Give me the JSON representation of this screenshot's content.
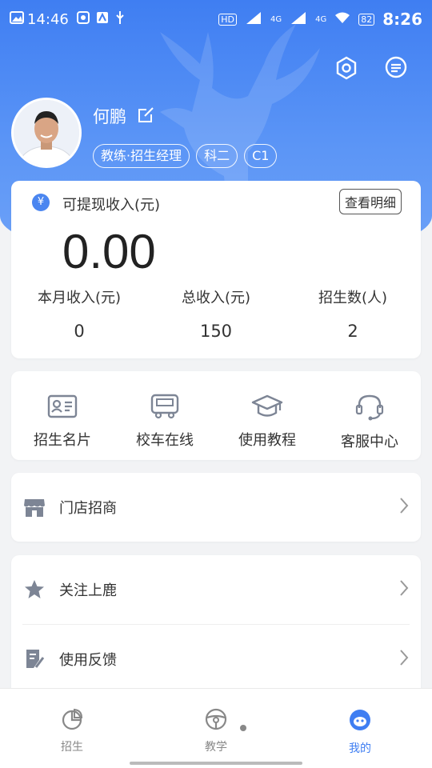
{
  "status_bar": {
    "left_time": "14:46",
    "clock": "8:26",
    "network_a": "4G",
    "network_b": "4G",
    "hd": "HD",
    "battery": "82"
  },
  "profile": {
    "name": "何鹏",
    "tags": [
      "教练·招生经理",
      "科二",
      "C1"
    ]
  },
  "income": {
    "withdrawable_label": "可提现收入(元)",
    "withdrawable_amount": "0.00",
    "detail_button": "查看明细",
    "stats": [
      {
        "label": "本月收入(元)",
        "value": "0"
      },
      {
        "label": "总收入(元)",
        "value": "150"
      },
      {
        "label": "招生数(人)",
        "value": "2"
      }
    ]
  },
  "services": [
    {
      "label": "招生名片",
      "icon": "id-card-icon"
    },
    {
      "label": "校车在线",
      "icon": "bus-icon"
    },
    {
      "label": "使用教程",
      "icon": "graduation-cap-icon"
    },
    {
      "label": "客服中心",
      "icon": "headset-icon"
    }
  ],
  "menu": {
    "store": "门店招商",
    "follow": "关注上鹿",
    "feedback": "使用反馈"
  },
  "tabbar": {
    "tabs": [
      {
        "label": "招生",
        "icon": "pie-chart-icon"
      },
      {
        "label": "教学",
        "icon": "steering-wheel-icon"
      },
      {
        "label": "我的",
        "icon": "mascot-icon"
      }
    ],
    "active_index": 2
  },
  "colors": {
    "accent": "#3f7ef2",
    "icon_gray": "#7d8595"
  }
}
